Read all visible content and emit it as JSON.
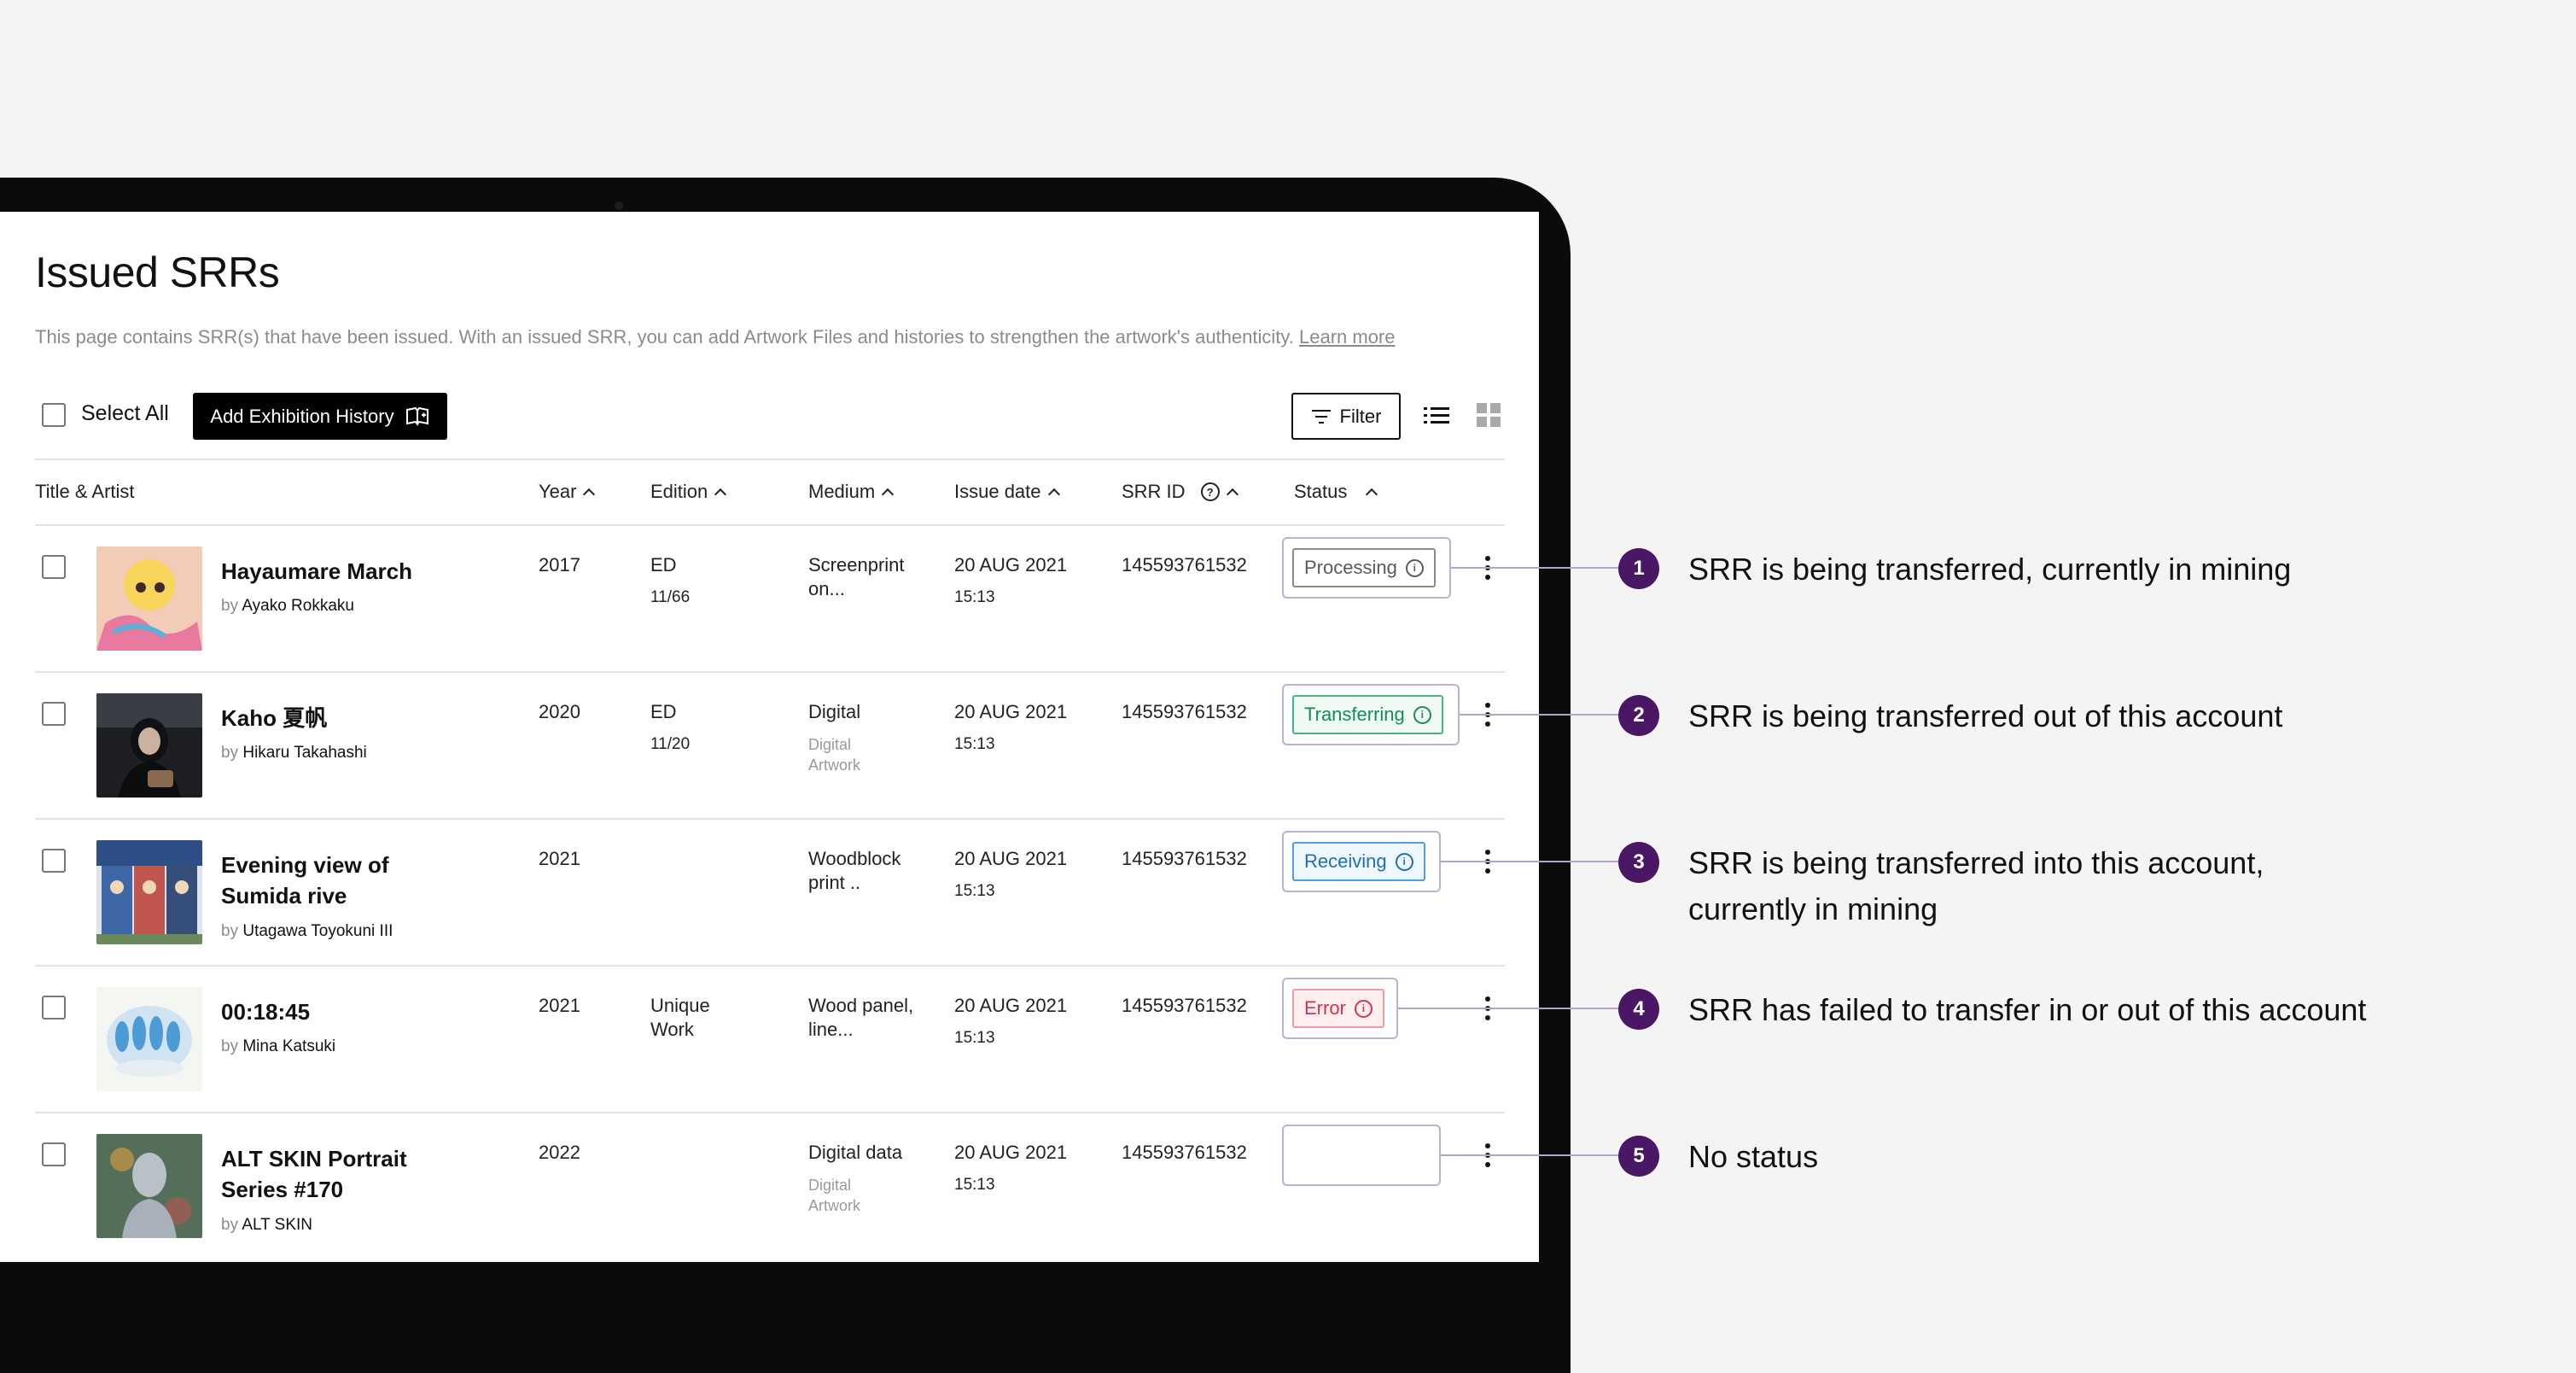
{
  "page": {
    "title": "Issued SRRs",
    "description": "This page contains SRR(s) that have been issued. With an issued SRR, you can add Artwork Files and histories to strengthen the artwork's authenticity.",
    "learn_more": "Learn more"
  },
  "toolbar": {
    "select_all": "Select All",
    "add_exhibition": "Add Exhibition History",
    "filter": "Filter"
  },
  "columns": {
    "title_artist": "Title & Artist",
    "year": "Year",
    "edition": "Edition",
    "medium": "Medium",
    "issue_date": "Issue date",
    "srr_id": "SRR ID",
    "status": "Status"
  },
  "rows": [
    {
      "title": "Hayaumare March",
      "by": "by",
      "artist": "Ayako Rokkaku",
      "year": "2017",
      "edition": "ED",
      "edition_num": "11/66",
      "medium": "Screenprint on...",
      "medium_sub": "",
      "date": "20 AUG 2021",
      "time": "15:13",
      "srr_id": "145593761532",
      "status": "Processing"
    },
    {
      "title": "Kaho 夏帆",
      "by": "by",
      "artist": "Hikaru Takahashi",
      "year": "2020",
      "edition": "ED",
      "edition_num": "11/20",
      "medium": "Digital",
      "medium_sub": "Digital Artwork",
      "date": "20 AUG 2021",
      "time": "15:13",
      "srr_id": "145593761532",
      "status": "Transferring"
    },
    {
      "title": "Evening view of Sumida rive",
      "by": "by",
      "artist": "Utagawa Toyokuni III",
      "year": "2021",
      "edition": "",
      "edition_num": "",
      "medium": "Woodblock print ..",
      "medium_sub": "",
      "date": "20 AUG 2021",
      "time": "15:13",
      "srr_id": "145593761532",
      "status": "Receiving"
    },
    {
      "title": "00:18:45",
      "by": "by",
      "artist": "Mina Katsuki",
      "year": "2021",
      "edition": "Unique Work",
      "edition_num": "",
      "medium": "Wood panel, line...",
      "medium_sub": "",
      "date": "20 AUG 2021",
      "time": "15:13",
      "srr_id": "145593761532",
      "status": "Error"
    },
    {
      "title": "ALT SKIN Portrait Series #170",
      "by": "by",
      "artist": "ALT SKIN",
      "year": "2022",
      "edition": "",
      "edition_num": "",
      "medium": "Digital data",
      "medium_sub": "Digital Artwork",
      "date": "20 AUG 2021",
      "time": "15:13",
      "srr_id": "145593761532",
      "status": ""
    }
  ],
  "annotations": [
    {
      "num": "1",
      "text": "SRR is being transferred, currently in mining"
    },
    {
      "num": "2",
      "text": "SRR is being transferred out of this account"
    },
    {
      "num": "3",
      "text": "SRR is being transferred into this account,",
      "text2": "currently in mining"
    },
    {
      "num": "4",
      "text": "SRR has failed to transfer in or out of this account"
    },
    {
      "num": "5",
      "text": "No status"
    }
  ],
  "status_colors": {
    "Processing": {
      "fg": "#5a5a5a",
      "border": "#8a8a8a",
      "bg": "#ffffff"
    },
    "Transferring": {
      "fg": "#1b8a5a",
      "border": "#49b584",
      "bg": "#eefaf3"
    },
    "Receiving": {
      "fg": "#1f6fb8",
      "border": "#4da1de",
      "bg": "#eef7fd"
    },
    "Error": {
      "fg": "#d2344a",
      "border": "#ef9aa6",
      "bg": "#fdeef0"
    }
  },
  "icons": {
    "filter": "filter-lines-icon",
    "list_view": "list-view-icon",
    "grid_view": "grid-view-icon",
    "add": "book-plus-icon",
    "info": "info-circle-icon",
    "help": "question-circle-icon"
  }
}
